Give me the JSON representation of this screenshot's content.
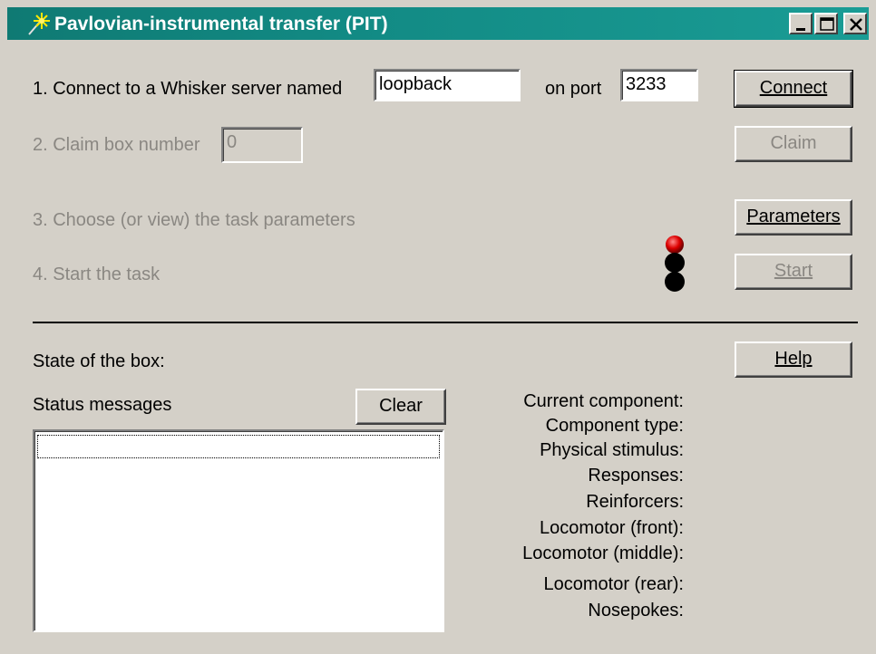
{
  "window": {
    "title": "Pavlovian-instrumental transfer (PIT)",
    "title_icon": "sparkle-icon",
    "controls": [
      "minimize-icon",
      "maximize-icon",
      "close-icon"
    ],
    "titlebar_color": "#128a84"
  },
  "steps": {
    "connect_label": "1. Connect to a Whisker server named",
    "server_value": "loopback",
    "port_label": "on port",
    "port_value": "3233",
    "claim_label": "2. Claim box number",
    "box_value": "0",
    "params_label": "3. Choose (or view) the task parameters",
    "start_label": "4. Start the task"
  },
  "buttons": {
    "connect": "Connect",
    "claim": "Claim",
    "parameters": "Parameters",
    "start": "Start",
    "help": "Help",
    "clear": "Clear"
  },
  "traffic_light": {
    "icon": "traffic-light-icon",
    "red": "#cc0000",
    "off": "#000000"
  },
  "status": {
    "box_state_label": "State of the box:",
    "messages_label": "Status messages",
    "messages": []
  },
  "details": [
    "Current component:",
    "Component type:",
    "Physical stimulus:",
    "Responses:",
    "Reinforcers:",
    "Locomotor (front):",
    "Locomotor (middle):",
    "Locomotor (rear):",
    "Nosepokes:"
  ]
}
